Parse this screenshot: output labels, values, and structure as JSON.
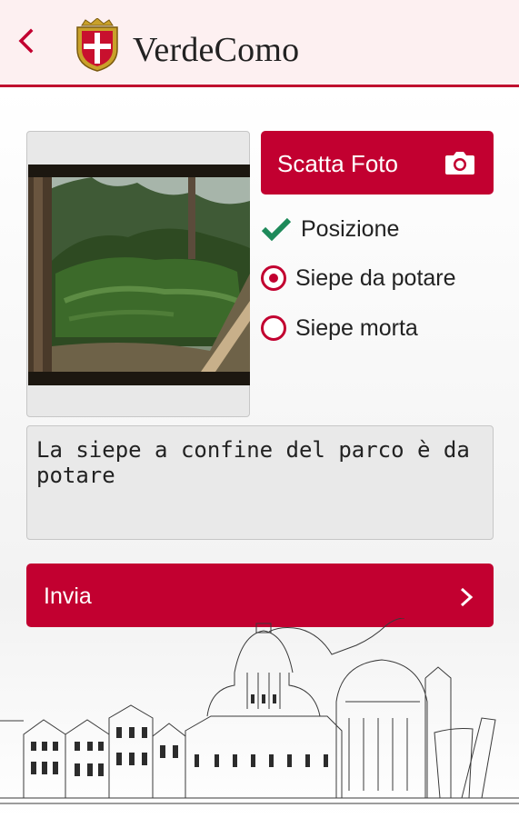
{
  "header": {
    "title": "VerdeComo",
    "back_icon": "chevron-left-icon",
    "logo_icon": "como-crest-icon"
  },
  "capture": {
    "take_photo_label": "Scatta Foto",
    "camera_icon": "camera-icon"
  },
  "status": {
    "position_label": "Posizione",
    "position_checked": true,
    "check_icon": "checkmark-icon"
  },
  "options": [
    {
      "label": "Siepe da potare",
      "selected": true
    },
    {
      "label": "Siepe morta",
      "selected": false
    }
  ],
  "note": {
    "value": "La siepe a confine del parco è da potare"
  },
  "submit": {
    "label": "Invia",
    "chevron_icon": "chevron-right-icon"
  },
  "colors": {
    "accent": "#c20030",
    "header_bg": "#fdf0f1",
    "check_green": "#1e8a5a"
  }
}
